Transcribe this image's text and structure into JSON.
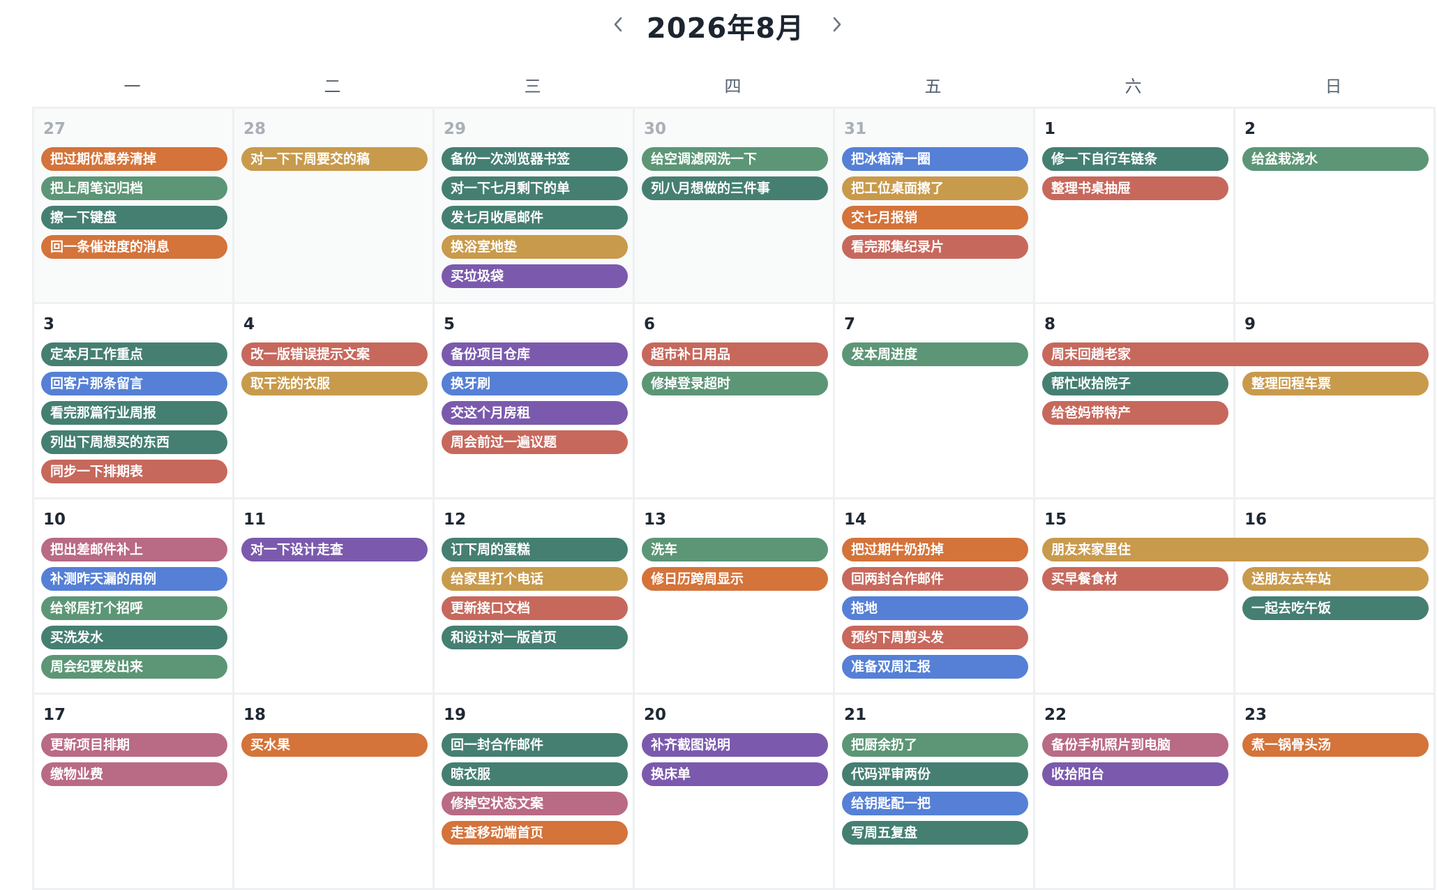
{
  "calendar": {
    "title": "2026年8月",
    "prev_icon": "chevron-left-icon",
    "next_icon": "chevron-right-icon",
    "weekdays": [
      "一",
      "二",
      "三",
      "四",
      "五",
      "六",
      "日"
    ]
  },
  "colors": {
    "orange": "#d4733a",
    "mustard": "#c89a4c",
    "green": "#5c9676",
    "teal": "#457f72",
    "blue": "#5580d6",
    "purple": "#7b5aad",
    "red": "#c7685c",
    "pink": "#b96a84"
  },
  "weeks": [
    {
      "days": [
        {
          "num": "27",
          "other": true
        },
        {
          "num": "28",
          "other": true
        },
        {
          "num": "29",
          "other": true
        },
        {
          "num": "30",
          "other": true
        },
        {
          "num": "31",
          "other": true
        },
        {
          "num": "1"
        },
        {
          "num": "2"
        }
      ],
      "events": [
        {
          "title": "把过期优惠券清掉",
          "col": 0,
          "span": 1,
          "row": 0,
          "color": "orange"
        },
        {
          "title": "把上周笔记归档",
          "col": 0,
          "span": 1,
          "row": 1,
          "color": "green"
        },
        {
          "title": "擦一下键盘",
          "col": 0,
          "span": 1,
          "row": 2,
          "color": "teal"
        },
        {
          "title": "回一条催进度的消息",
          "col": 0,
          "span": 1,
          "row": 3,
          "color": "orange"
        },
        {
          "title": "对一下下周要交的稿",
          "col": 1,
          "span": 1,
          "row": 0,
          "color": "mustard"
        },
        {
          "title": "备份一次浏览器书签",
          "col": 2,
          "span": 1,
          "row": 0,
          "color": "teal"
        },
        {
          "title": "对一下七月剩下的单",
          "col": 2,
          "span": 1,
          "row": 1,
          "color": "teal"
        },
        {
          "title": "发七月收尾邮件",
          "col": 2,
          "span": 1,
          "row": 2,
          "color": "teal"
        },
        {
          "title": "换浴室地垫",
          "col": 2,
          "span": 1,
          "row": 3,
          "color": "mustard"
        },
        {
          "title": "买垃圾袋",
          "col": 2,
          "span": 1,
          "row": 4,
          "color": "purple"
        },
        {
          "title": "给空调滤网洗一下",
          "col": 3,
          "span": 1,
          "row": 0,
          "color": "green"
        },
        {
          "title": "列八月想做的三件事",
          "col": 3,
          "span": 1,
          "row": 1,
          "color": "teal"
        },
        {
          "title": "把冰箱清一圈",
          "col": 4,
          "span": 1,
          "row": 0,
          "color": "blue"
        },
        {
          "title": "把工位桌面擦了",
          "col": 4,
          "span": 1,
          "row": 1,
          "color": "mustard"
        },
        {
          "title": "交七月报销",
          "col": 4,
          "span": 1,
          "row": 2,
          "color": "orange"
        },
        {
          "title": "看完那集纪录片",
          "col": 4,
          "span": 1,
          "row": 3,
          "color": "red"
        },
        {
          "title": "修一下自行车链条",
          "col": 5,
          "span": 1,
          "row": 0,
          "color": "teal"
        },
        {
          "title": "整理书桌抽屉",
          "col": 5,
          "span": 1,
          "row": 1,
          "color": "red"
        },
        {
          "title": "给盆栽浇水",
          "col": 6,
          "span": 1,
          "row": 0,
          "color": "green"
        }
      ]
    },
    {
      "days": [
        {
          "num": "3"
        },
        {
          "num": "4"
        },
        {
          "num": "5"
        },
        {
          "num": "6"
        },
        {
          "num": "7"
        },
        {
          "num": "8"
        },
        {
          "num": "9"
        }
      ],
      "events": [
        {
          "title": "定本月工作重点",
          "col": 0,
          "span": 1,
          "row": 0,
          "color": "teal"
        },
        {
          "title": "回客户那条留言",
          "col": 0,
          "span": 1,
          "row": 1,
          "color": "blue"
        },
        {
          "title": "看完那篇行业周报",
          "col": 0,
          "span": 1,
          "row": 2,
          "color": "teal"
        },
        {
          "title": "列出下周想买的东西",
          "col": 0,
          "span": 1,
          "row": 3,
          "color": "teal"
        },
        {
          "title": "同步一下排期表",
          "col": 0,
          "span": 1,
          "row": 4,
          "color": "red"
        },
        {
          "title": "改一版错误提示文案",
          "col": 1,
          "span": 1,
          "row": 0,
          "color": "red"
        },
        {
          "title": "取干洗的衣服",
          "col": 1,
          "span": 1,
          "row": 1,
          "color": "mustard"
        },
        {
          "title": "备份项目仓库",
          "col": 2,
          "span": 1,
          "row": 0,
          "color": "purple"
        },
        {
          "title": "换牙刷",
          "col": 2,
          "span": 1,
          "row": 1,
          "color": "blue"
        },
        {
          "title": "交这个月房租",
          "col": 2,
          "span": 1,
          "row": 2,
          "color": "purple"
        },
        {
          "title": "周会前过一遍议题",
          "col": 2,
          "span": 1,
          "row": 3,
          "color": "red"
        },
        {
          "title": "超市补日用品",
          "col": 3,
          "span": 1,
          "row": 0,
          "color": "red"
        },
        {
          "title": "修掉登录超时",
          "col": 3,
          "span": 1,
          "row": 1,
          "color": "green"
        },
        {
          "title": "发本周进度",
          "col": 4,
          "span": 1,
          "row": 0,
          "color": "green"
        },
        {
          "title": "周末回趟老家",
          "col": 5,
          "span": 2,
          "row": 0,
          "color": "red"
        },
        {
          "title": "帮忙收拾院子",
          "col": 5,
          "span": 1,
          "row": 1,
          "color": "teal"
        },
        {
          "title": "给爸妈带特产",
          "col": 5,
          "span": 1,
          "row": 2,
          "color": "red"
        },
        {
          "title": "整理回程车票",
          "col": 6,
          "span": 1,
          "row": 1,
          "color": "mustard"
        }
      ]
    },
    {
      "days": [
        {
          "num": "10"
        },
        {
          "num": "11"
        },
        {
          "num": "12"
        },
        {
          "num": "13"
        },
        {
          "num": "14"
        },
        {
          "num": "15"
        },
        {
          "num": "16"
        }
      ],
      "events": [
        {
          "title": "把出差邮件补上",
          "col": 0,
          "span": 1,
          "row": 0,
          "color": "pink"
        },
        {
          "title": "补测昨天漏的用例",
          "col": 0,
          "span": 1,
          "row": 1,
          "color": "blue"
        },
        {
          "title": "给邻居打个招呼",
          "col": 0,
          "span": 1,
          "row": 2,
          "color": "green"
        },
        {
          "title": "买洗发水",
          "col": 0,
          "span": 1,
          "row": 3,
          "color": "teal"
        },
        {
          "title": "周会纪要发出来",
          "col": 0,
          "span": 1,
          "row": 4,
          "color": "green"
        },
        {
          "title": "对一下设计走查",
          "col": 1,
          "span": 1,
          "row": 0,
          "color": "purple"
        },
        {
          "title": "订下周的蛋糕",
          "col": 2,
          "span": 1,
          "row": 0,
          "color": "teal"
        },
        {
          "title": "给家里打个电话",
          "col": 2,
          "span": 1,
          "row": 1,
          "color": "mustard"
        },
        {
          "title": "更新接口文档",
          "col": 2,
          "span": 1,
          "row": 2,
          "color": "red"
        },
        {
          "title": "和设计对一版首页",
          "col": 2,
          "span": 1,
          "row": 3,
          "color": "teal"
        },
        {
          "title": "洗车",
          "col": 3,
          "span": 1,
          "row": 0,
          "color": "green"
        },
        {
          "title": "修日历跨周显示",
          "col": 3,
          "span": 1,
          "row": 1,
          "color": "orange"
        },
        {
          "title": "把过期牛奶扔掉",
          "col": 4,
          "span": 1,
          "row": 0,
          "color": "orange"
        },
        {
          "title": "回两封合作邮件",
          "col": 4,
          "span": 1,
          "row": 1,
          "color": "red"
        },
        {
          "title": "拖地",
          "col": 4,
          "span": 1,
          "row": 2,
          "color": "blue"
        },
        {
          "title": "预约下周剪头发",
          "col": 4,
          "span": 1,
          "row": 3,
          "color": "red"
        },
        {
          "title": "准备双周汇报",
          "col": 4,
          "span": 1,
          "row": 4,
          "color": "blue"
        },
        {
          "title": "朋友来家里住",
          "col": 5,
          "span": 2,
          "row": 0,
          "color": "mustard"
        },
        {
          "title": "买早餐食材",
          "col": 5,
          "span": 1,
          "row": 1,
          "color": "red"
        },
        {
          "title": "送朋友去车站",
          "col": 6,
          "span": 1,
          "row": 1,
          "color": "mustard"
        },
        {
          "title": "一起去吃午饭",
          "col": 6,
          "span": 1,
          "row": 2,
          "color": "teal"
        }
      ]
    },
    {
      "days": [
        {
          "num": "17"
        },
        {
          "num": "18"
        },
        {
          "num": "19"
        },
        {
          "num": "20"
        },
        {
          "num": "21"
        },
        {
          "num": "22"
        },
        {
          "num": "23"
        }
      ],
      "events": [
        {
          "title": "更新项目排期",
          "col": 0,
          "span": 1,
          "row": 0,
          "color": "pink"
        },
        {
          "title": "缴物业费",
          "col": 0,
          "span": 1,
          "row": 1,
          "color": "pink"
        },
        {
          "title": "买水果",
          "col": 1,
          "span": 1,
          "row": 0,
          "color": "orange"
        },
        {
          "title": "回一封合作邮件",
          "col": 2,
          "span": 1,
          "row": 0,
          "color": "teal"
        },
        {
          "title": "晾衣服",
          "col": 2,
          "span": 1,
          "row": 1,
          "color": "teal"
        },
        {
          "title": "修掉空状态文案",
          "col": 2,
          "span": 1,
          "row": 2,
          "color": "pink"
        },
        {
          "title": "走查移动端首页",
          "col": 2,
          "span": 1,
          "row": 3,
          "color": "orange"
        },
        {
          "title": "补齐截图说明",
          "col": 3,
          "span": 1,
          "row": 0,
          "color": "purple"
        },
        {
          "title": "换床单",
          "col": 3,
          "span": 1,
          "row": 1,
          "color": "purple"
        },
        {
          "title": "把厨余扔了",
          "col": 4,
          "span": 1,
          "row": 0,
          "color": "green"
        },
        {
          "title": "代码评审两份",
          "col": 4,
          "span": 1,
          "row": 1,
          "color": "teal"
        },
        {
          "title": "给钥匙配一把",
          "col": 4,
          "span": 1,
          "row": 2,
          "color": "blue"
        },
        {
          "title": "写周五复盘",
          "col": 4,
          "span": 1,
          "row": 3,
          "color": "teal"
        },
        {
          "title": "备份手机照片到电脑",
          "col": 5,
          "span": 1,
          "row": 0,
          "color": "pink"
        },
        {
          "title": "收拾阳台",
          "col": 5,
          "span": 1,
          "row": 1,
          "color": "purple"
        },
        {
          "title": "煮一锅骨头汤",
          "col": 6,
          "span": 1,
          "row": 0,
          "color": "orange"
        }
      ]
    }
  ]
}
